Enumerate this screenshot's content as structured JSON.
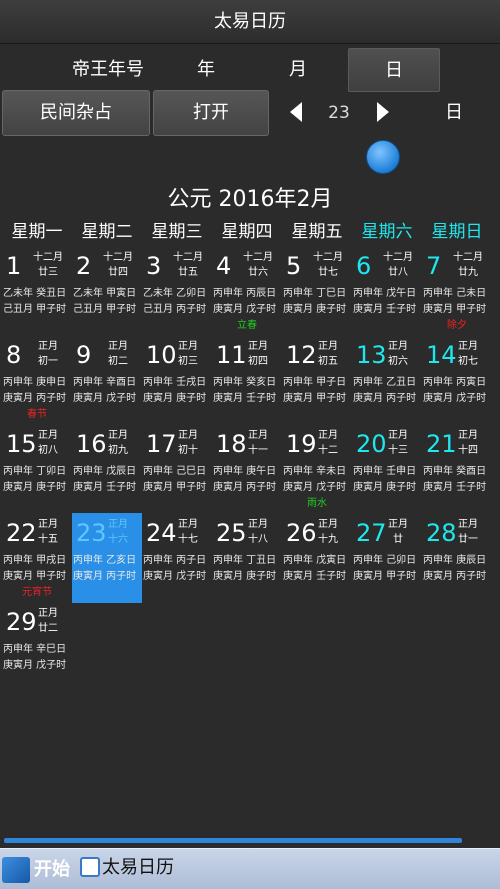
{
  "app": {
    "title": "太易日历"
  },
  "header_row": {
    "emperor_label": "帝王年号",
    "year_label": "年",
    "month_label": "月",
    "day_button": "日"
  },
  "control_row": {
    "folk_button": "民间杂占",
    "open_button": "打开",
    "day_value": "23",
    "day_unit": "日",
    "prev_icon": "triangle-left-icon",
    "next_icon": "triangle-right-icon"
  },
  "slider": {
    "value": 23
  },
  "calendar": {
    "title": "公元 2016年2月",
    "weekdays": [
      "星期一",
      "星期二",
      "星期三",
      "星期四",
      "星期五",
      "星期六",
      "星期日"
    ],
    "days": [
      {
        "day": "1",
        "lunar1": "十二月",
        "lunar2": "廿三",
        "gz1": "乙未年 癸丑日",
        "gz2": "己丑月 甲子时",
        "term": ""
      },
      {
        "day": "2",
        "lunar1": "十二月",
        "lunar2": "廿四",
        "gz1": "乙未年 甲寅日",
        "gz2": "己丑月 甲子时",
        "term": ""
      },
      {
        "day": "3",
        "lunar1": "十二月",
        "lunar2": "廿五",
        "gz1": "乙未年 乙卯日",
        "gz2": "己丑月 丙子时",
        "term": ""
      },
      {
        "day": "4",
        "lunar1": "十二月",
        "lunar2": "廿六",
        "gz1": "丙申年 丙辰日",
        "gz2": "庚寅月 戊子时",
        "term": "立春"
      },
      {
        "day": "5",
        "lunar1": "十二月",
        "lunar2": "廿七",
        "gz1": "丙申年 丁巳日",
        "gz2": "庚寅月 庚子时",
        "term": ""
      },
      {
        "day": "6",
        "lunar1": "十二月",
        "lunar2": "廿八",
        "gz1": "丙申年 戊午日",
        "gz2": "庚寅月 壬子时",
        "term": ""
      },
      {
        "day": "7",
        "lunar1": "十二月",
        "lunar2": "廿九",
        "gz1": "丙申年 己未日",
        "gz2": "庚寅月 甲子时",
        "term": "除夕"
      },
      {
        "day": "8",
        "lunar1": "正月",
        "lunar2": "初一",
        "gz1": "丙申年 庚申日",
        "gz2": "庚寅月 丙子时",
        "term": "春节"
      },
      {
        "day": "9",
        "lunar1": "正月",
        "lunar2": "初二",
        "gz1": "丙申年 辛酉日",
        "gz2": "庚寅月 戊子时",
        "term": ""
      },
      {
        "day": "10",
        "lunar1": "正月",
        "lunar2": "初三",
        "gz1": "丙申年 壬戌日",
        "gz2": "庚寅月 庚子时",
        "term": ""
      },
      {
        "day": "11",
        "lunar1": "正月",
        "lunar2": "初四",
        "gz1": "丙申年 癸亥日",
        "gz2": "庚寅月 壬子时",
        "term": ""
      },
      {
        "day": "12",
        "lunar1": "正月",
        "lunar2": "初五",
        "gz1": "丙申年 甲子日",
        "gz2": "庚寅月 甲子时",
        "term": ""
      },
      {
        "day": "13",
        "lunar1": "正月",
        "lunar2": "初六",
        "gz1": "丙申年 乙丑日",
        "gz2": "庚寅月 丙子时",
        "term": ""
      },
      {
        "day": "14",
        "lunar1": "正月",
        "lunar2": "初七",
        "gz1": "丙申年 丙寅日",
        "gz2": "庚寅月 戊子时",
        "term": ""
      },
      {
        "day": "15",
        "lunar1": "正月",
        "lunar2": "初八",
        "gz1": "丙申年 丁卯日",
        "gz2": "庚寅月 庚子时",
        "term": ""
      },
      {
        "day": "16",
        "lunar1": "正月",
        "lunar2": "初九",
        "gz1": "丙申年 戊辰日",
        "gz2": "庚寅月 壬子时",
        "term": ""
      },
      {
        "day": "17",
        "lunar1": "正月",
        "lunar2": "初十",
        "gz1": "丙申年 己巳日",
        "gz2": "庚寅月 甲子时",
        "term": ""
      },
      {
        "day": "18",
        "lunar1": "正月",
        "lunar2": "十一",
        "gz1": "丙申年 庚午日",
        "gz2": "庚寅月 丙子时",
        "term": ""
      },
      {
        "day": "19",
        "lunar1": "正月",
        "lunar2": "十二",
        "gz1": "丙申年 辛未日",
        "gz2": "庚寅月 戊子时",
        "term": "雨水"
      },
      {
        "day": "20",
        "lunar1": "正月",
        "lunar2": "十三",
        "gz1": "丙申年 壬申日",
        "gz2": "庚寅月 庚子时",
        "term": ""
      },
      {
        "day": "21",
        "lunar1": "正月",
        "lunar2": "十四",
        "gz1": "丙申年 癸酉日",
        "gz2": "庚寅月 壬子时",
        "term": ""
      },
      {
        "day": "22",
        "lunar1": "正月",
        "lunar2": "十五",
        "gz1": "丙申年 甲戌日",
        "gz2": "庚寅月 甲子时",
        "term": "元宵节"
      },
      {
        "day": "23",
        "lunar1": "正月",
        "lunar2": "十六",
        "gz1": "丙申年 乙亥日",
        "gz2": "庚寅月 丙子时",
        "term": ""
      },
      {
        "day": "24",
        "lunar1": "正月",
        "lunar2": "十七",
        "gz1": "丙申年 丙子日",
        "gz2": "庚寅月 戊子时",
        "term": ""
      },
      {
        "day": "25",
        "lunar1": "正月",
        "lunar2": "十八",
        "gz1": "丙申年 丁丑日",
        "gz2": "庚寅月 庚子时",
        "term": ""
      },
      {
        "day": "26",
        "lunar1": "正月",
        "lunar2": "十九",
        "gz1": "丙申年 戊寅日",
        "gz2": "庚寅月 壬子时",
        "term": ""
      },
      {
        "day": "27",
        "lunar1": "正月",
        "lunar2": "廿",
        "gz1": "丙申年 己卯日",
        "gz2": "庚寅月 甲子时",
        "term": ""
      },
      {
        "day": "28",
        "lunar1": "正月",
        "lunar2": "廿一",
        "gz1": "丙申年 庚辰日",
        "gz2": "庚寅月 丙子时",
        "term": ""
      },
      {
        "day": "29",
        "lunar1": "正月",
        "lunar2": "廿二",
        "gz1": "丙申年 辛巳日",
        "gz2": "庚寅月 戊子时",
        "term": ""
      }
    ],
    "selected_day": "23"
  },
  "taskbar": {
    "start_label": "开始",
    "start_icon": "windows-start-icon",
    "task_label": "太易日历",
    "task_icon": "calendar-app-icon"
  },
  "colors": {
    "background": "#2b2b2b",
    "weekend": "#1ee8ee",
    "selected": "#2a8fe6",
    "solar_term": "#22cc22",
    "festival": "#ee2222",
    "accent": "#2f86d8"
  }
}
